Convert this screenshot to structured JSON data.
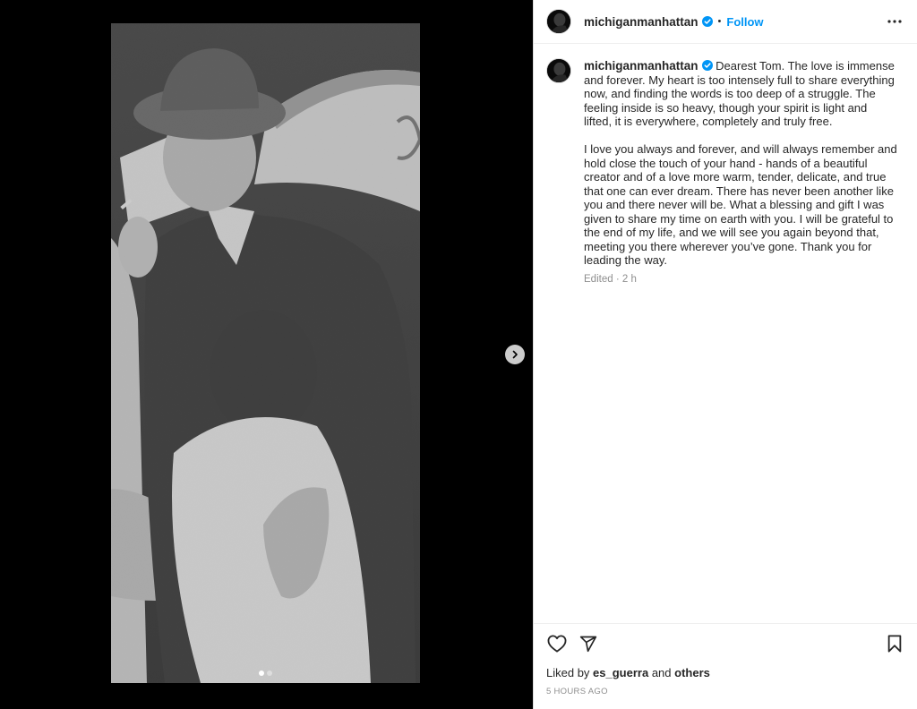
{
  "post": {
    "username": "michiganmanhattan",
    "separator": "•",
    "follow_label": "Follow",
    "verified_icon": "verified-badge-icon",
    "more_icon": "more-options-icon"
  },
  "media": {
    "image_description_icon": "photo",
    "next_icon": "chevron-right-icon",
    "carousel_count": 2,
    "carousel_active": 1
  },
  "caption": {
    "username": "michiganmanhattan",
    "paragraph1": "Dearest Tom. The love is immense and forever. My heart is too intensely full to share everything now, and finding the words is too deep of a struggle. The feeling inside is so heavy, though your spirit is light and lifted, it is everywhere, completely and truly free.",
    "paragraph2": "I love you always and forever, and will always remember and hold close the touch of your hand - hands of a beautiful creator and of a love more warm, tender, delicate, and true that one can ever dream. There has never been another like you and there never will be. What a blessing and gift I was given to share my time on earth with you. I will be grateful to the end of my life, and we will see you again beyond that, meeting you there wherever you’ve gone. Thank you for leading the way.",
    "edited_label": "Edited",
    "meta_separator": "·",
    "relative_time": "2 h"
  },
  "actions": {
    "like_icon": "heart-icon",
    "share_icon": "send-icon",
    "save_icon": "bookmark-icon",
    "liked_by_prefix": "Liked by",
    "liked_by_user": "es_guerra",
    "liked_by_and": "and",
    "liked_by_others": "others",
    "timestamp": "5 HOURS AGO"
  },
  "colors": {
    "accent": "#0095f6",
    "verified": "#0095f6",
    "text": "#262626",
    "secondary_text": "#8e8e8e"
  }
}
